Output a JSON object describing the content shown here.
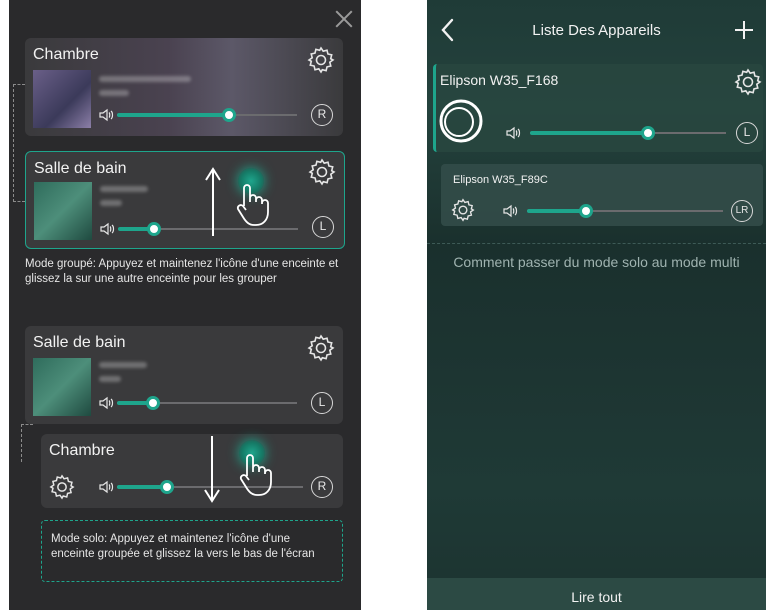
{
  "left": {
    "group_card_top": {
      "name": "Chambre",
      "channel": "R",
      "volume_fraction": 0.62
    },
    "group_card_bottom": {
      "name": "Salle de bain",
      "channel": "L",
      "volume_fraction": 0.2
    },
    "group_hint": "Mode groupé: Appuyez et maintenez l'icône d'une enceinte et glissez la sur une autre enceinte pour les grouper",
    "solo_card_top": {
      "name": "Salle de bain",
      "channel": "L",
      "volume_fraction": 0.2
    },
    "solo_card_bottom": {
      "name": "Chambre",
      "channel": "R",
      "volume_fraction": 0.27
    },
    "solo_hint": "Mode solo: Appuyez et maintenez l'icône d'une enceinte groupée et glissez la vers le bas de l'écran"
  },
  "right": {
    "nav_title": "Liste Des Appareils",
    "devices": [
      {
        "name": "Elipson W35_F168",
        "channel": "L",
        "volume_fraction": 0.6
      },
      {
        "name": "Elipson W35_F89C",
        "channel": "LR",
        "volume_fraction": 0.3
      }
    ],
    "help_link": "Comment passer du mode solo au mode multi",
    "play_all": "Lire tout"
  },
  "colors": {
    "accent": "#1ea58c",
    "left_bg": "#2a2a2c",
    "card_bg": "#3a3a3c"
  },
  "icons": [
    "close-icon",
    "gear-icon",
    "volume-icon",
    "hand-pointer-icon",
    "arrow-up-icon",
    "arrow-down-icon",
    "back-chevron-icon",
    "plus-icon",
    "play-ring-icon"
  ]
}
